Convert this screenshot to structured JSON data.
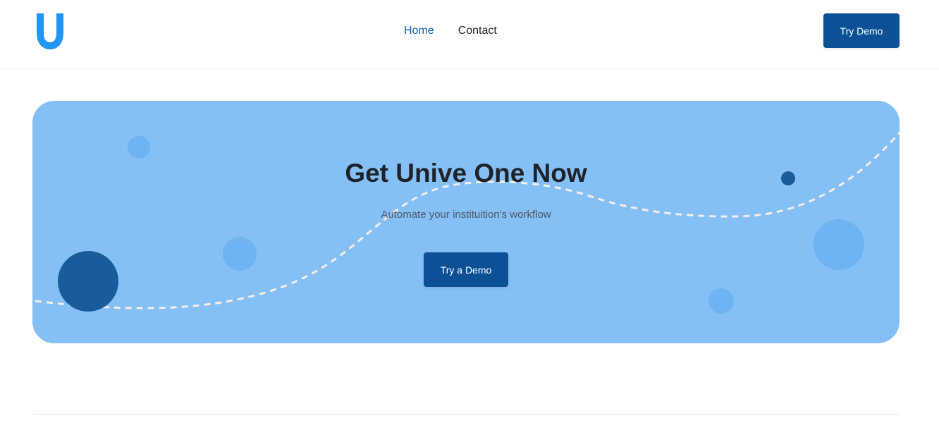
{
  "header": {
    "logo_icon": "u-logo-icon",
    "nav": [
      {
        "label": "Home",
        "active": true
      },
      {
        "label": "Contact",
        "active": false
      }
    ],
    "cta_label": "Try Demo"
  },
  "hero": {
    "title": "Get Unive One Now",
    "subtitle": "Automate your instituition's workflow",
    "button_label": "Try a Demo"
  },
  "colors": {
    "accent": "#0c5196",
    "logo": "#2195f3",
    "hero_background": "#84bff5",
    "nav_active": "#0e5ea8",
    "decorative_dark": "#185c9c",
    "decorative_light": "#6eb3f2",
    "dashed_wave": "#f7eee8"
  }
}
